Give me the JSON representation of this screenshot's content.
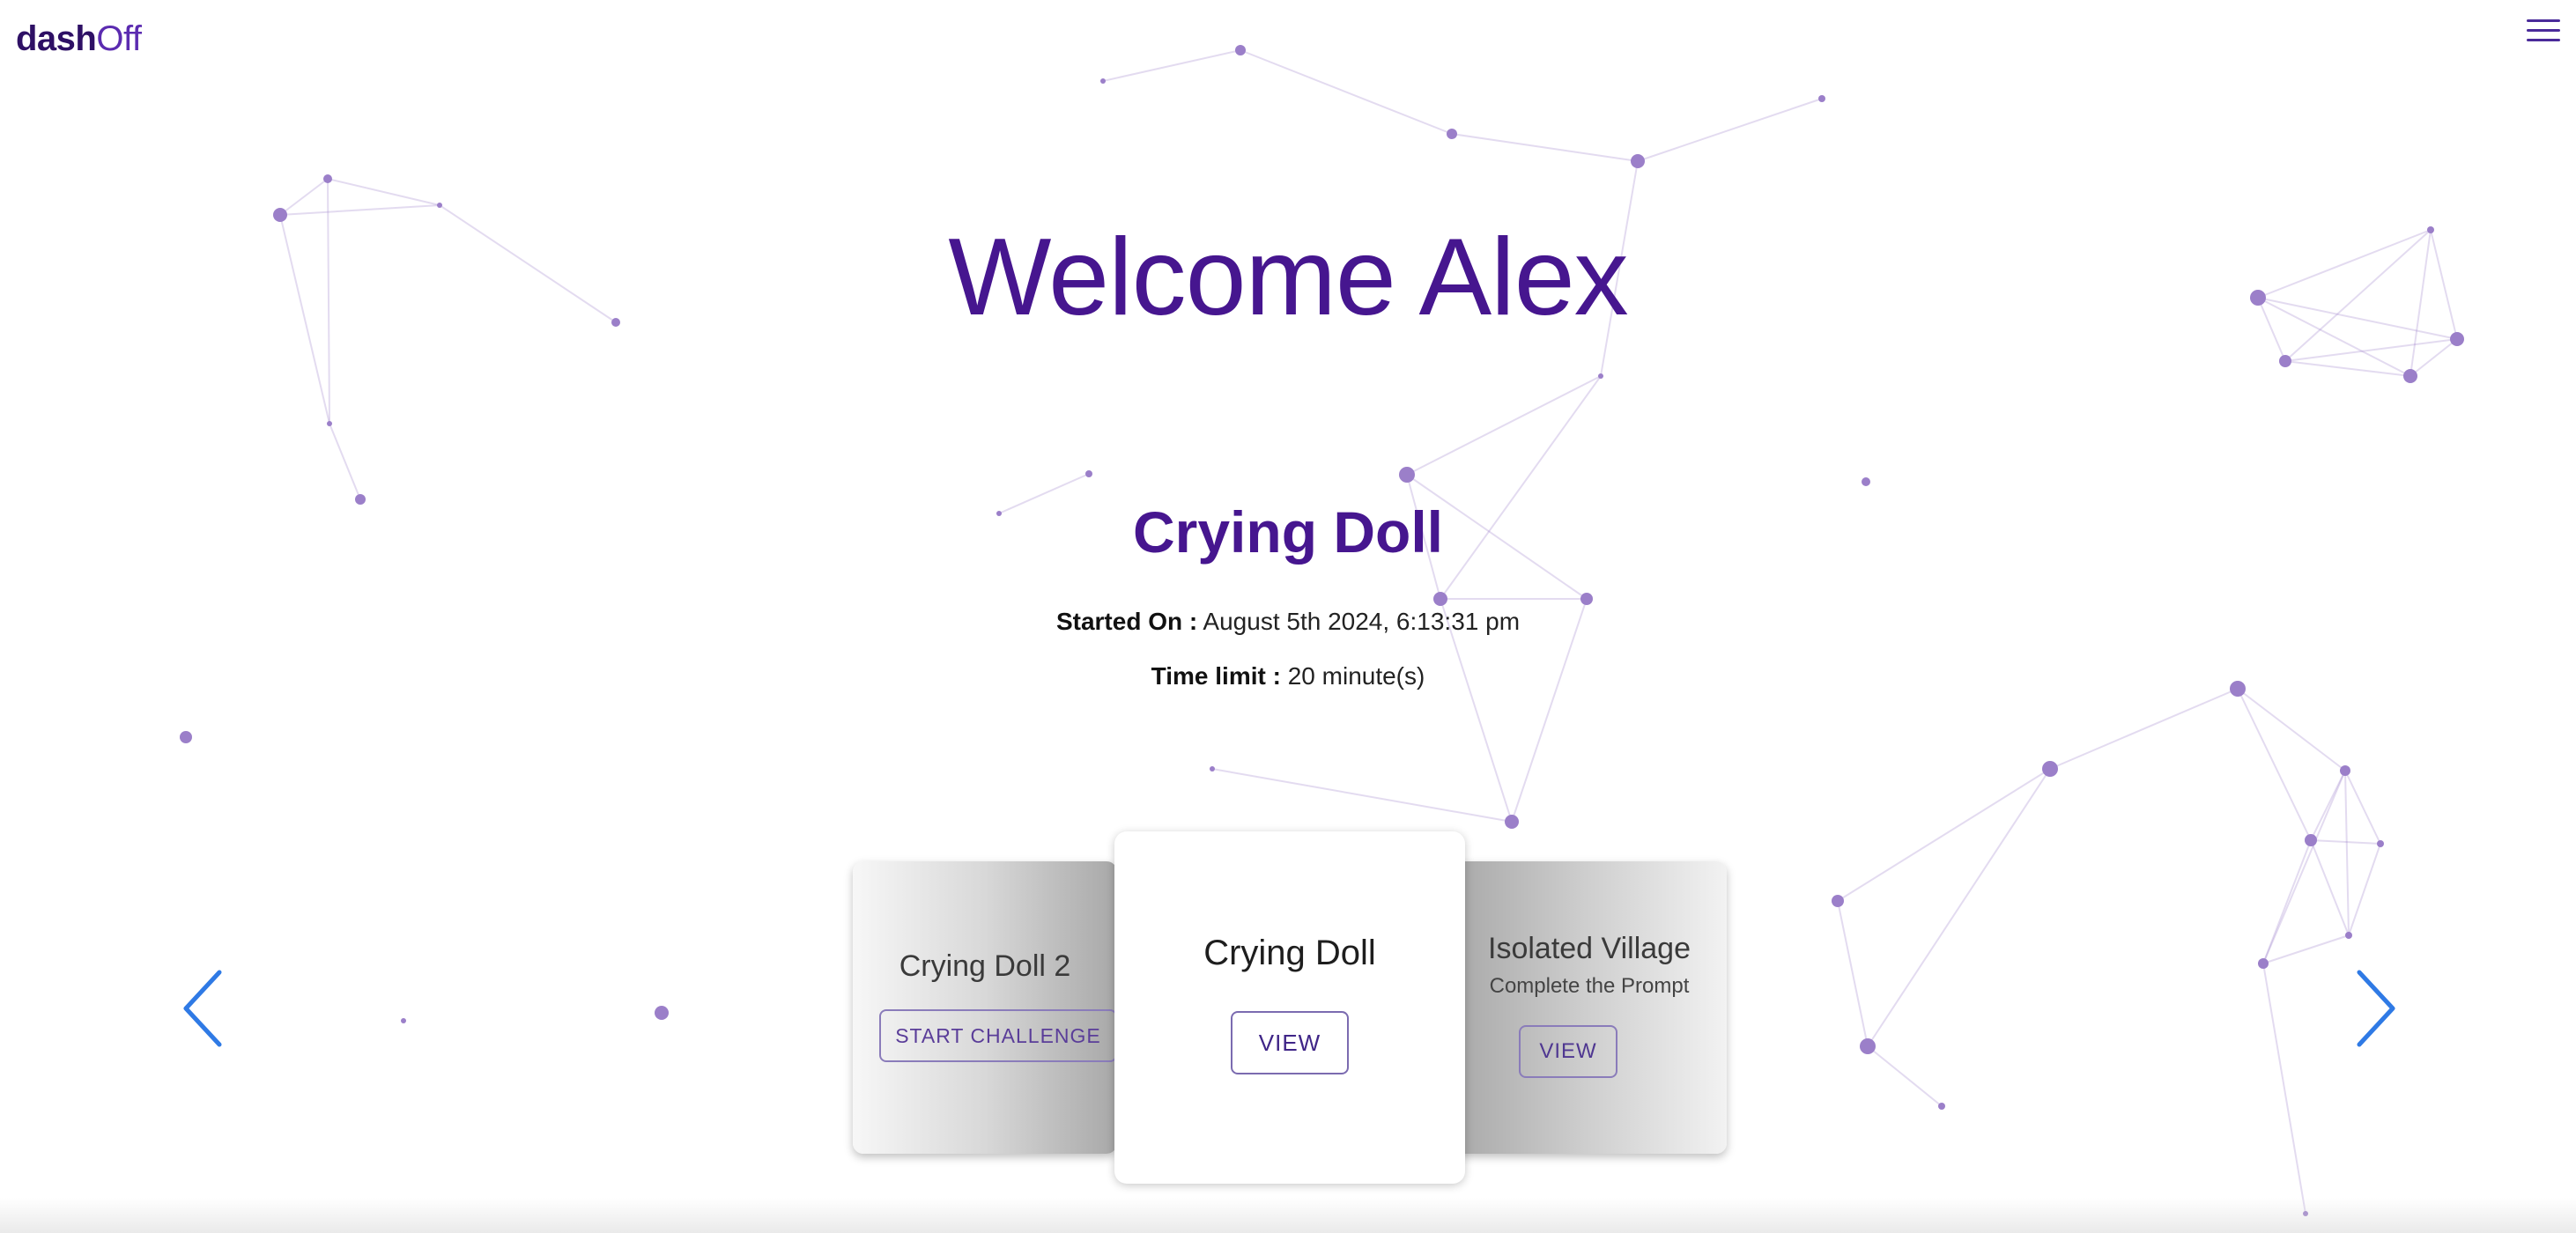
{
  "header": {
    "logo_part1": "dash",
    "logo_part2": "Off",
    "menu_icon": "hamburger-menu-icon"
  },
  "hero": {
    "welcome_text": "Welcome Alex"
  },
  "current_challenge": {
    "title": "Crying Doll",
    "started_label": "Started On :",
    "started_value": "August 5th 2024, 6:13:31 pm",
    "time_limit_label": "Time limit :",
    "time_limit_value": "20 minute(s)"
  },
  "carousel": {
    "prev_icon": "chevron-left-icon",
    "next_icon": "chevron-right-icon",
    "cards": [
      {
        "title": "Crying Doll 2",
        "subtitle": "",
        "button": "START CHALLENGE"
      },
      {
        "title": "Crying Doll",
        "subtitle": "",
        "button": "VIEW"
      },
      {
        "title": "Isolated Village",
        "subtitle": "Complete the Prompt",
        "button": "VIEW"
      }
    ]
  },
  "colors": {
    "brand_purple": "#46168f",
    "logo_dark": "#2e1065",
    "arrow_blue": "#2f7ae5",
    "node_purple": "#9b7fc9"
  }
}
